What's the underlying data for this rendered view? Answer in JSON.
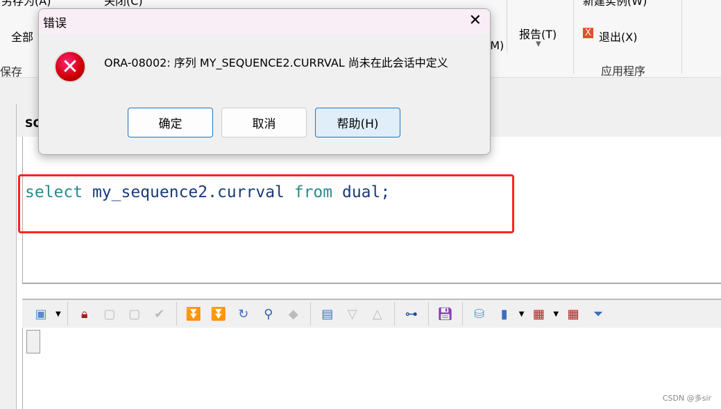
{
  "ribbon": {
    "save_as": "另存为(A)",
    "close": "关闭(C)",
    "save_all": "全部",
    "save_group": "保存",
    "menu_m": "(M)",
    "report": "报告(T)",
    "new_instance": "新建实例(W)",
    "exit": "退出(X)",
    "app_group": "应用程序"
  },
  "editor": {
    "tab_label": "SQ",
    "sql_kw1": "select",
    "sql_mid": " my_sequence2.currval ",
    "sql_kw2": "from",
    "sql_end": " dual;",
    "highlight_color": "#ff2222"
  },
  "toolbar": {
    "icons": [
      "select-mode-icon",
      "lock-icon",
      "new-record-icon",
      "delete-record-icon",
      "commit-icon",
      "fetch-next-icon",
      "fetch-last-icon",
      "refresh-icon",
      "find-icon",
      "clear-icon",
      "form-view-icon",
      "sort-desc-icon",
      "sort-asc-icon",
      "tree-icon",
      "save-icon",
      "database-export-icon",
      "chart-icon",
      "grid-icon",
      "grid-copy-icon",
      "filter-icon"
    ]
  },
  "dialog": {
    "title": "错误",
    "message": "ORA-08002: 序列 MY_SEQUENCE2.CURRVAL 尚未在此会话中定义",
    "ok": "确定",
    "cancel": "取消",
    "help": "帮助(H)"
  },
  "watermark": "CSDN @多sir"
}
